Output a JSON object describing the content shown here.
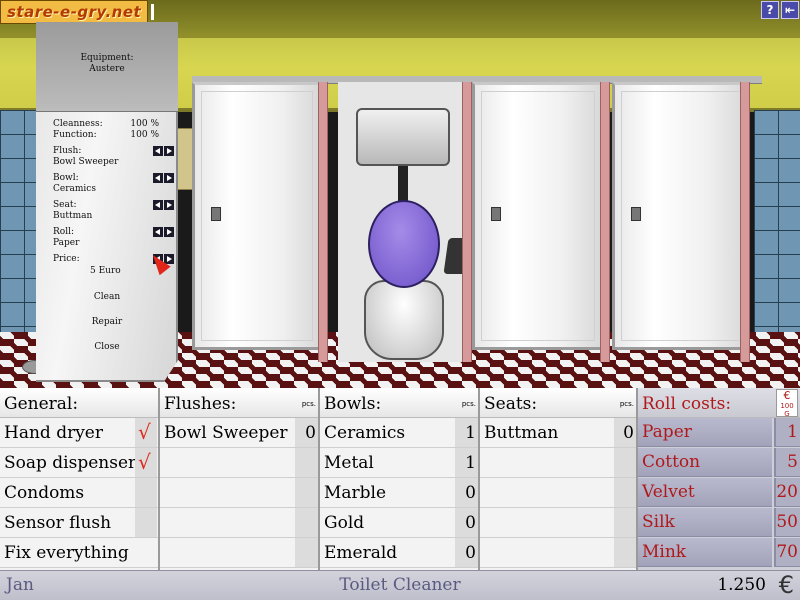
{
  "logo": {
    "text": "stare-e-gry.net"
  },
  "top_buttons": {
    "help": "?",
    "exit": "⇤"
  },
  "equipment": {
    "title": "Equipment:",
    "level": "Austere",
    "cleanness_label": "Cleanness:",
    "cleanness_value": "100 %",
    "function_label": "Function:",
    "function_value": "100 %",
    "flush_label": "Flush:",
    "flush_value": "Bowl Sweeper",
    "bowl_label": "Bowl:",
    "bowl_value": "Ceramics",
    "seat_label": "Seat:",
    "seat_value": "Buttman",
    "roll_label": "Roll:",
    "roll_value": "Paper",
    "price_label": "Price:",
    "price_value": "5 Euro",
    "clean": "Clean",
    "repair": "Repair",
    "close": "Close"
  },
  "general": {
    "title": "General:",
    "items": [
      {
        "label": "Hand dryer",
        "checked": "√"
      },
      {
        "label": "Soap dispenser",
        "checked": "√"
      },
      {
        "label": "Condoms",
        "checked": ""
      },
      {
        "label": "Sensor flush",
        "checked": ""
      },
      {
        "label": "Fix everything",
        "checked": ""
      }
    ]
  },
  "flushes": {
    "title": "Flushes:",
    "pcs": "pcs.",
    "items": [
      {
        "label": "Bowl Sweeper",
        "count": "0"
      }
    ]
  },
  "bowls": {
    "title": "Bowls:",
    "pcs": "pcs.",
    "items": [
      {
        "label": "Ceramics",
        "count": "1"
      },
      {
        "label": "Metal",
        "count": "1"
      },
      {
        "label": "Marble",
        "count": "0"
      },
      {
        "label": "Gold",
        "count": "0"
      },
      {
        "label": "Emerald",
        "count": "0"
      }
    ]
  },
  "seats": {
    "title": "Seats:",
    "pcs": "pcs.",
    "items": [
      {
        "label": "Buttman",
        "count": "0"
      }
    ]
  },
  "rolls": {
    "title": "Roll costs:",
    "currency_symbol": "€",
    "currency_unit": "100 G",
    "items": [
      {
        "label": "Paper",
        "price": "1"
      },
      {
        "label": "Cotton",
        "price": "5"
      },
      {
        "label": "Velvet",
        "price": "20"
      },
      {
        "label": "Silk",
        "price": "50"
      },
      {
        "label": "Mink",
        "price": "70"
      }
    ]
  },
  "status": {
    "player": "Jan",
    "job": "Toilet Cleaner",
    "money": "1.250",
    "currency": "€"
  },
  "colors": {
    "accent_red": "#b0191a",
    "check_red": "#e0261a",
    "status_text": "#5a5a80",
    "seat_purple": "#6a4fc6"
  }
}
